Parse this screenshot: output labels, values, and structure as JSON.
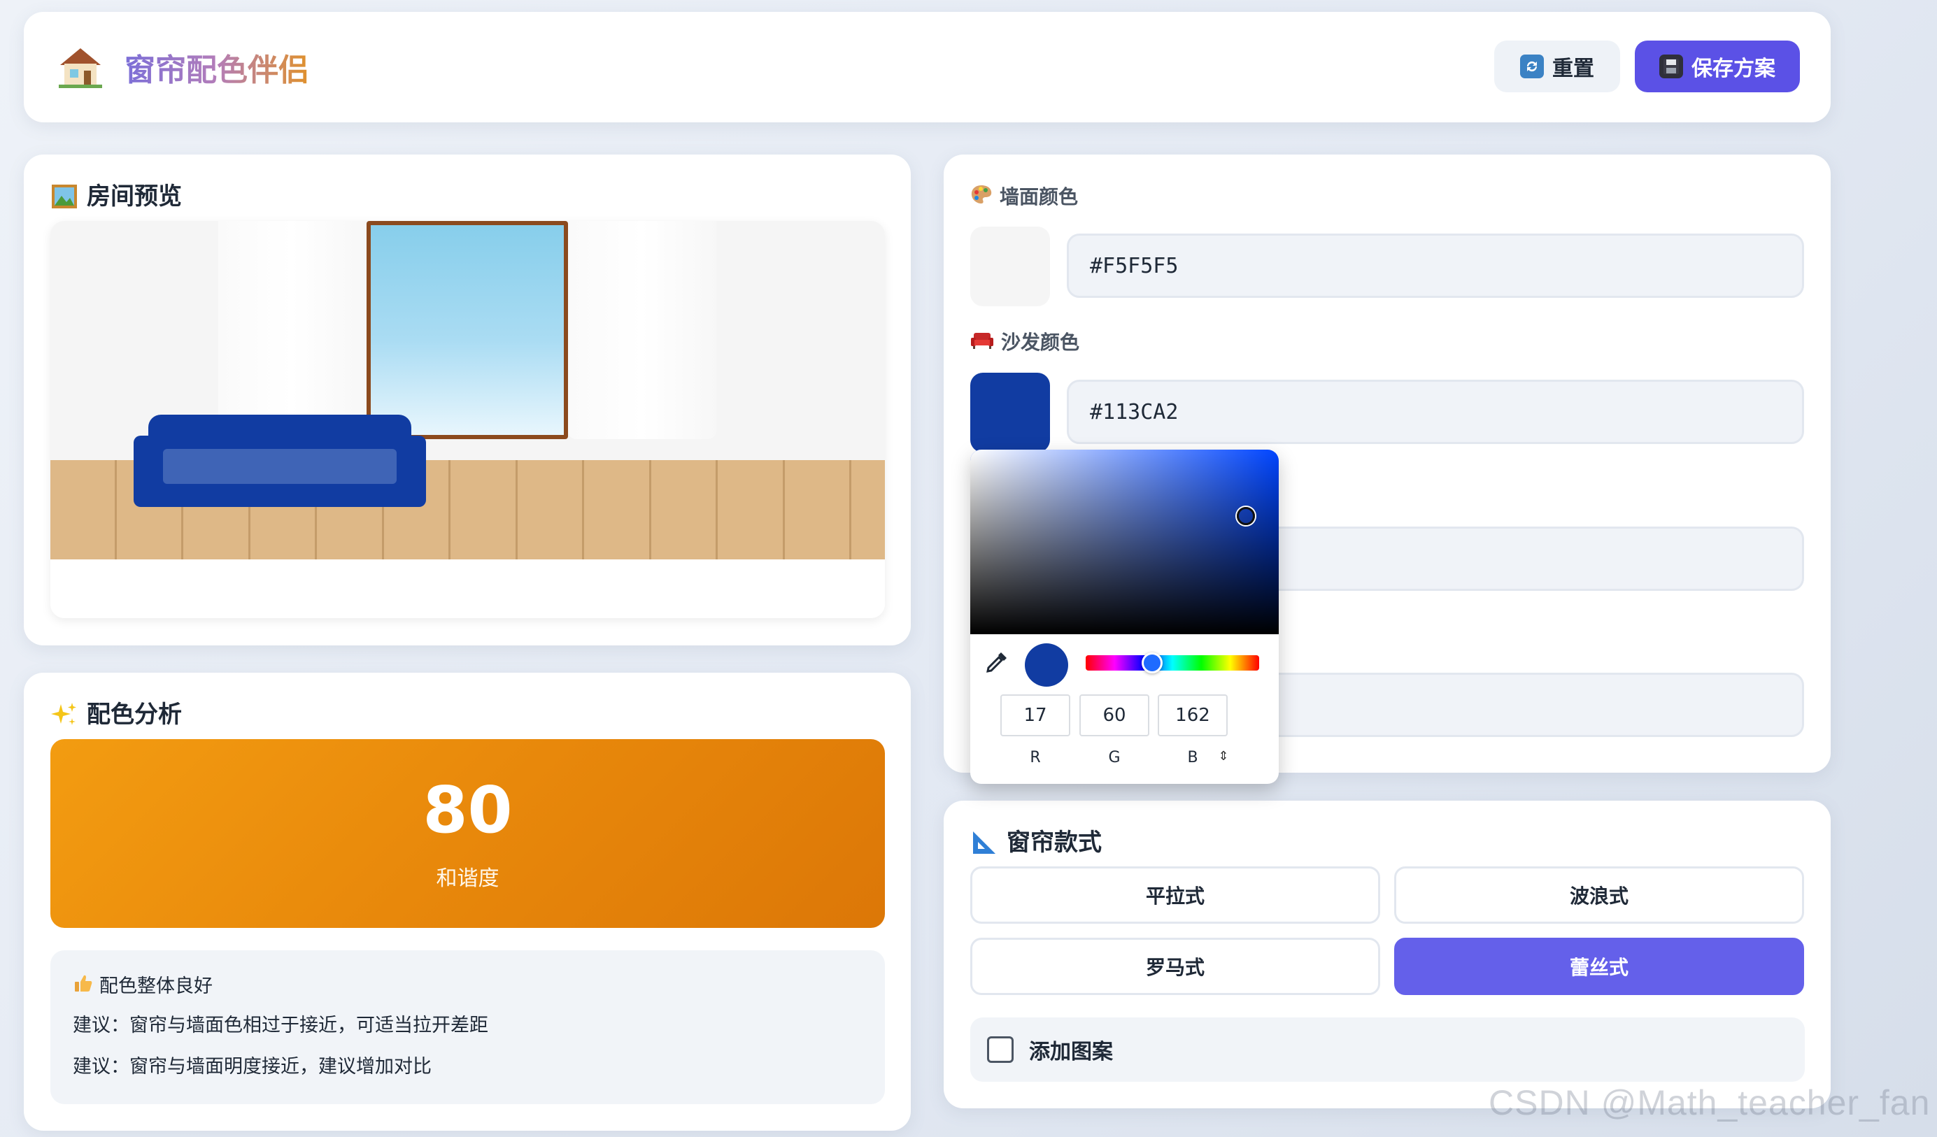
{
  "app": {
    "title": "窗帘配色伴侣",
    "logo_icon": "house-icon",
    "reset_label": "重置",
    "reset_icon": "refresh-icon",
    "save_label": "保存方案",
    "save_icon": "floppy-disk-icon",
    "accent_color": "#5b51e6"
  },
  "preview": {
    "title": "房间预览",
    "icon": "framed-picture-icon",
    "wall_color": "#F5F5F5",
    "sofa_color": "#113CA2",
    "floor_color": "#DEB887",
    "window_frame_color": "#8B4A1E"
  },
  "analysis": {
    "title": "配色分析",
    "icon": "sparkles-icon",
    "score": "80",
    "score_label": "和谐度",
    "tips": [
      {
        "icon": "thumbs-up-icon",
        "text": "配色整体良好"
      },
      {
        "text": "建议：窗帘与墙面色相过于接近，可适当拉开差距"
      },
      {
        "text": "建议：窗帘与墙面明度接近，建议增加对比"
      }
    ]
  },
  "colors": {
    "wall": {
      "label": "墙面颜色",
      "icon": "palette-icon",
      "value": "#F5F5F5"
    },
    "sofa": {
      "label": "沙发颜色",
      "icon": "couch-icon",
      "value": "#113CA2"
    }
  },
  "picker": {
    "r": "17",
    "g": "60",
    "b": "162",
    "r_label": "R",
    "g_label": "G",
    "b_label": "B",
    "eyedropper_icon": "eyedropper-icon",
    "mode_toggle_icon": "up-down-arrows-icon",
    "current_color": "#113CA2"
  },
  "style": {
    "title": "窗帘款式",
    "icon": "triangle-ruler-icon",
    "options": [
      "平拉式",
      "波浪式",
      "罗马式",
      "蕾丝式"
    ],
    "selected": "蕾丝式",
    "pattern_label": "添加图案",
    "pattern_checked": false
  },
  "watermark": "CSDN @Math_teacher_fan"
}
